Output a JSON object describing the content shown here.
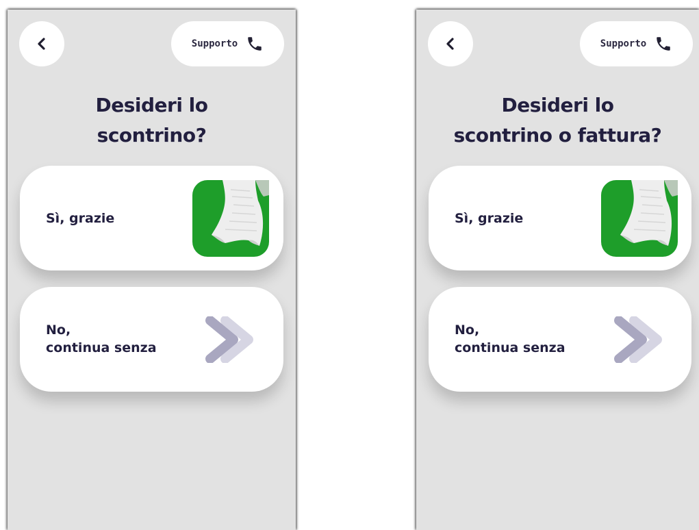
{
  "screens": [
    {
      "support_label": "Supporto",
      "title_line1": "Desideri lo",
      "title_line2": "scontrino?",
      "yes_label": "Sì, grazie",
      "no_label_line1": "No,",
      "no_label_line2": "continua senza"
    },
    {
      "support_label": "Supporto",
      "title_line1": "Desideri lo",
      "title_line2": "scontrino o fattura?",
      "yes_label": "Sì, grazie",
      "no_label_line1": "No,",
      "no_label_line2": "continua senza"
    }
  ],
  "icons": {
    "back": "chevron-left-icon",
    "support": "phone-icon",
    "yes": "receipt-icon",
    "no": "double-chevron-right-icon"
  },
  "colors": {
    "background": "#e2e2e2",
    "card": "#ffffff",
    "text": "#221f3f",
    "receipt_green": "#1e9e2a",
    "chevron_dark": "#a9a7c0",
    "chevron_light": "#d6d5e3"
  }
}
